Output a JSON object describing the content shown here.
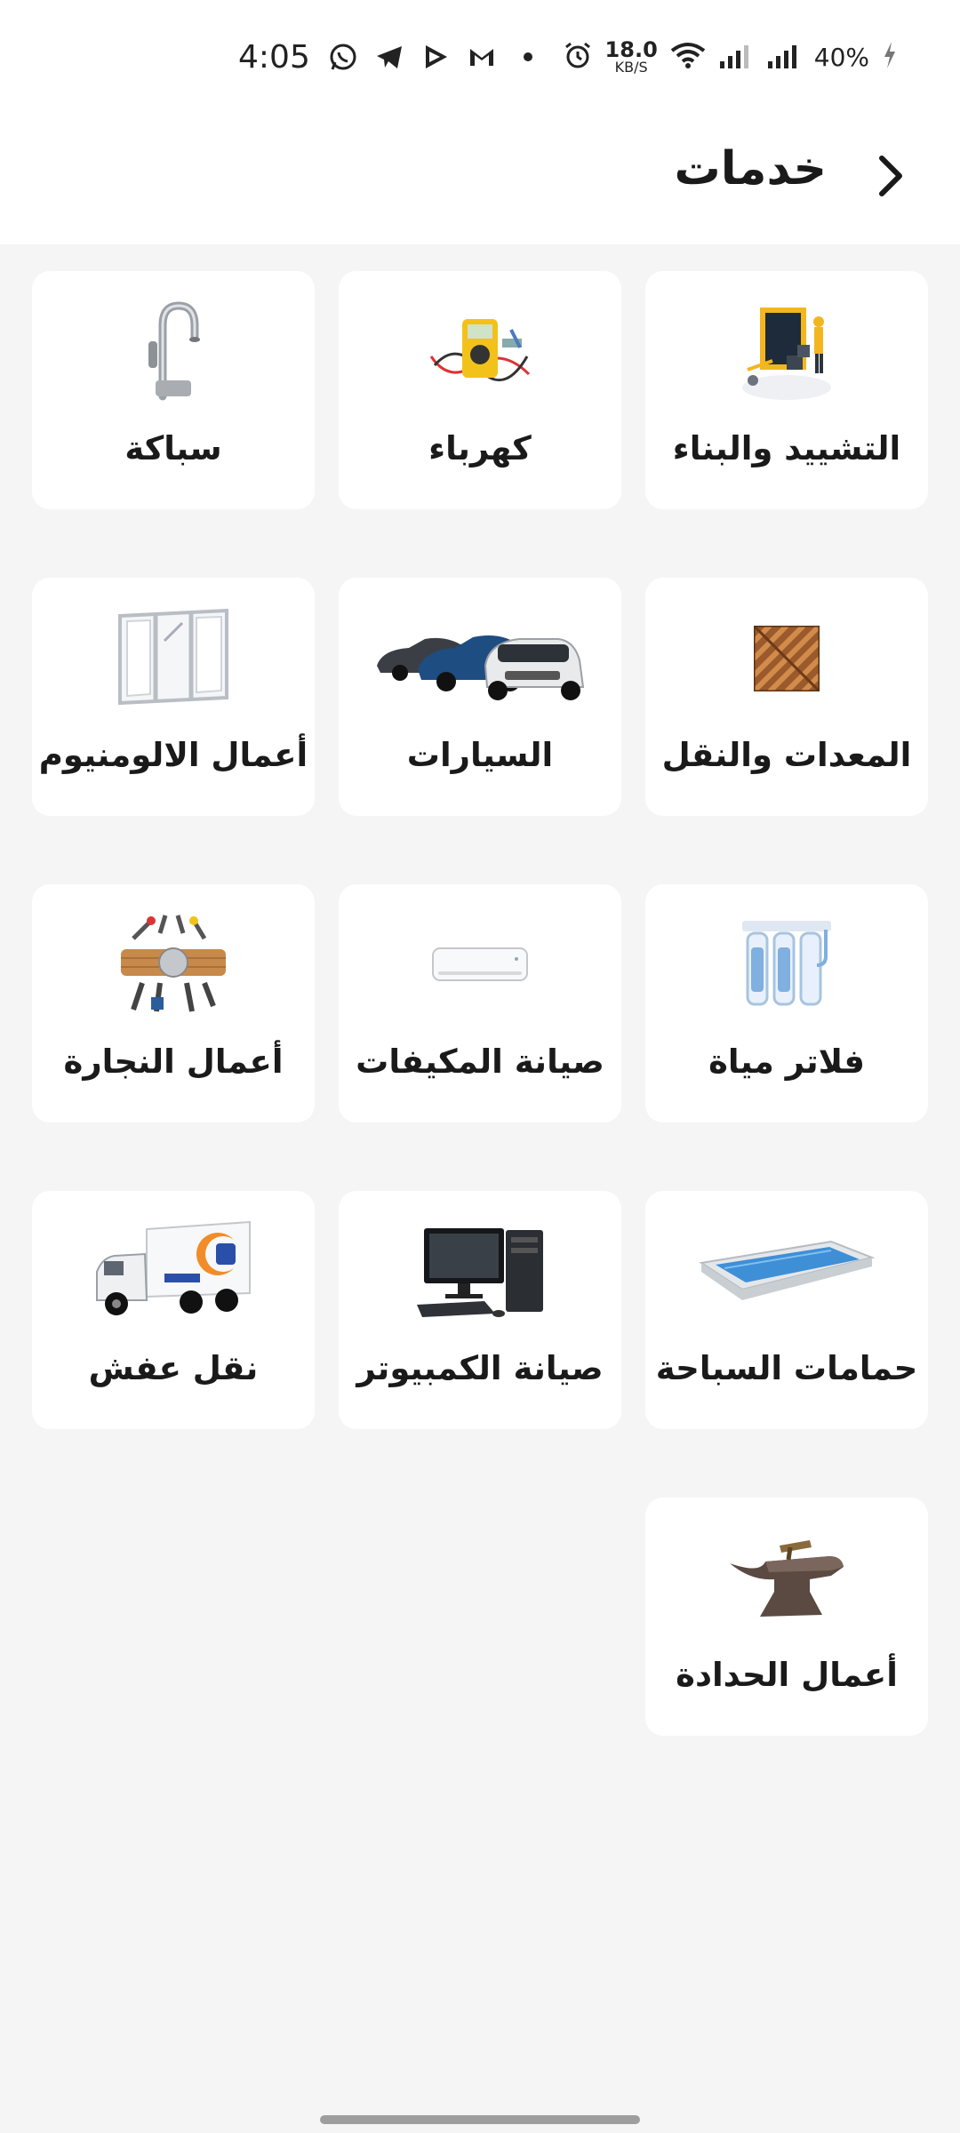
{
  "status": {
    "time": "4:05",
    "net_speed_value": "18.0",
    "net_speed_unit": "KB/S",
    "battery": "40%"
  },
  "header": {
    "title": "خدمات"
  },
  "services": [
    {
      "label": "التشييد والبناء",
      "icon": "construction-icon"
    },
    {
      "label": "كهرباء",
      "icon": "multimeter-icon"
    },
    {
      "label": "سباكة",
      "icon": "faucet-icon"
    },
    {
      "label": "المعدات والنقل",
      "icon": "parquet-tile-icon"
    },
    {
      "label": "السيارات",
      "icon": "cars-icon"
    },
    {
      "label": "أعمال الالومنيوم",
      "icon": "aluminum-window-icon"
    },
    {
      "label": "فلاتر مياة",
      "icon": "water-filter-icon"
    },
    {
      "label": "صيانة المكيفات",
      "icon": "air-conditioner-icon"
    },
    {
      "label": "أعمال النجارة",
      "icon": "carpentry-tools-icon"
    },
    {
      "label": "حمامات السباحة",
      "icon": "swimming-pool-icon"
    },
    {
      "label": "صيانة الكمبيوتر",
      "icon": "computer-icon"
    },
    {
      "label": "نقل عفش",
      "icon": "moving-truck-icon"
    },
    {
      "label": "أعمال الحدادة",
      "icon": "anvil-icon"
    }
  ]
}
